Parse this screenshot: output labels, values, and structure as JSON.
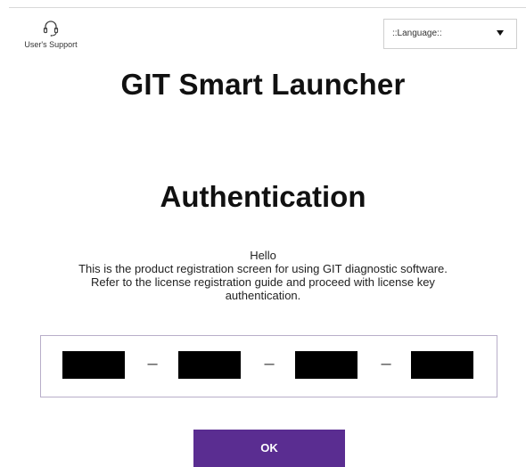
{
  "header": {
    "support_label": "User's Support",
    "support_icon": "headset-icon",
    "language": {
      "selected": "::Language::",
      "caret_icon": "caret-down-icon"
    }
  },
  "app_title": "GIT Smart Launcher",
  "auth": {
    "title": "Authentication",
    "greeting": "Hello",
    "line1": "This is the product registration screen for using GIT diagnostic software.",
    "line2": "Refer to the license registration guide and proceed with license key",
    "line3": "authentication."
  },
  "license_key": {
    "separator": "–",
    "segments": [
      "",
      "",
      "",
      ""
    ]
  },
  "ok_button": {
    "label": "OK"
  },
  "colors": {
    "accent": "#5a2d91",
    "key_field": "#000000",
    "border": "#b8aec9"
  }
}
